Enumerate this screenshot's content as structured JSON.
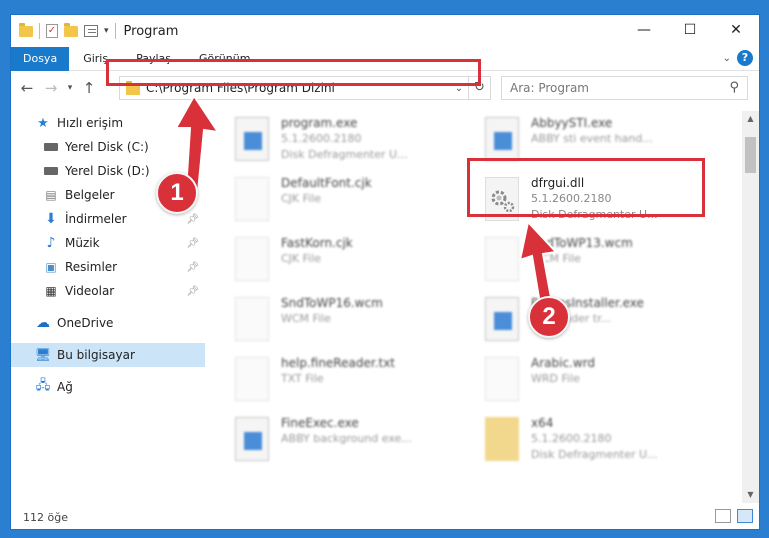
{
  "window": {
    "title": "Program",
    "controls": {
      "minimize": "—",
      "maximize": "☐",
      "close": "✕"
    }
  },
  "ribbon": {
    "tabs": [
      "Dosya",
      "Giriş",
      "Paylaş",
      "Görünüm"
    ]
  },
  "navigation": {
    "address": "C:\\Program Files\\Program Dizini",
    "search_placeholder": "Ara: Program"
  },
  "sidebar": {
    "items": [
      {
        "label": "Hızlı erişim",
        "icon": "star-icon"
      },
      {
        "label": "Yerel Disk (C:)",
        "icon": "drive-icon",
        "pinned": true
      },
      {
        "label": "Yerel Disk (D:)",
        "icon": "drive-icon",
        "pinned": true
      },
      {
        "label": "Belgeler",
        "icon": "documents-icon",
        "pinned": true
      },
      {
        "label": "İndirmeler",
        "icon": "download-icon",
        "pinned": true
      },
      {
        "label": "Müzik",
        "icon": "music-icon",
        "pinned": true
      },
      {
        "label": "Resimler",
        "icon": "pictures-icon",
        "pinned": true
      },
      {
        "label": "Videolar",
        "icon": "video-icon",
        "pinned": true
      },
      {
        "label": "OneDrive",
        "icon": "cloud-icon"
      },
      {
        "label": "Bu bilgisayar",
        "icon": "computer-icon",
        "selected": true
      },
      {
        "label": "Ağ",
        "icon": "network-icon"
      }
    ]
  },
  "files": [
    {
      "name": "program.exe",
      "line1": "5.1.2600.2180",
      "line2": "Disk Defragmenter U...",
      "type": "app"
    },
    {
      "name": "AbbyySTI.exe",
      "line1": "ABBY sti event hand...",
      "line2": "",
      "type": "app"
    },
    {
      "name": "DefaultFont.cjk",
      "line1": "CJK File",
      "line2": "",
      "type": "doc"
    },
    {
      "name": "dfrgui.dll",
      "line1": "5.1.2600.2180",
      "line2": "Disk Defragmenter U...",
      "type": "gear"
    },
    {
      "name": "FastKorn.cjk",
      "line1": "CJK File",
      "line2": "",
      "type": "doc"
    },
    {
      "name": "SndToWP13.wcm",
      "line1": "WCM File",
      "line2": "",
      "type": "doc"
    },
    {
      "name": "SndToWP16.wcm",
      "line1": "WCM File",
      "line2": "",
      "type": "doc"
    },
    {
      "name": "ReamsInstaller.exe",
      "line1": "Finereader tr...",
      "line2": "",
      "type": "app"
    },
    {
      "name": "help.fineReader.txt",
      "line1": "TXT File",
      "line2": "",
      "type": "doc"
    },
    {
      "name": "Arabic.wrd",
      "line1": "WRD File",
      "line2": "",
      "type": "doc"
    },
    {
      "name": "FineExec.exe",
      "line1": "ABBY background exe...",
      "line2": "",
      "type": "app"
    },
    {
      "name": "x64",
      "line1": "5.1.2600.2180",
      "line2": "Disk Defragmenter U...",
      "type": "folder"
    }
  ],
  "status": {
    "count": "112 öğe"
  },
  "annotations": {
    "step1": "1",
    "step2": "2",
    "color": "#d9313a"
  }
}
